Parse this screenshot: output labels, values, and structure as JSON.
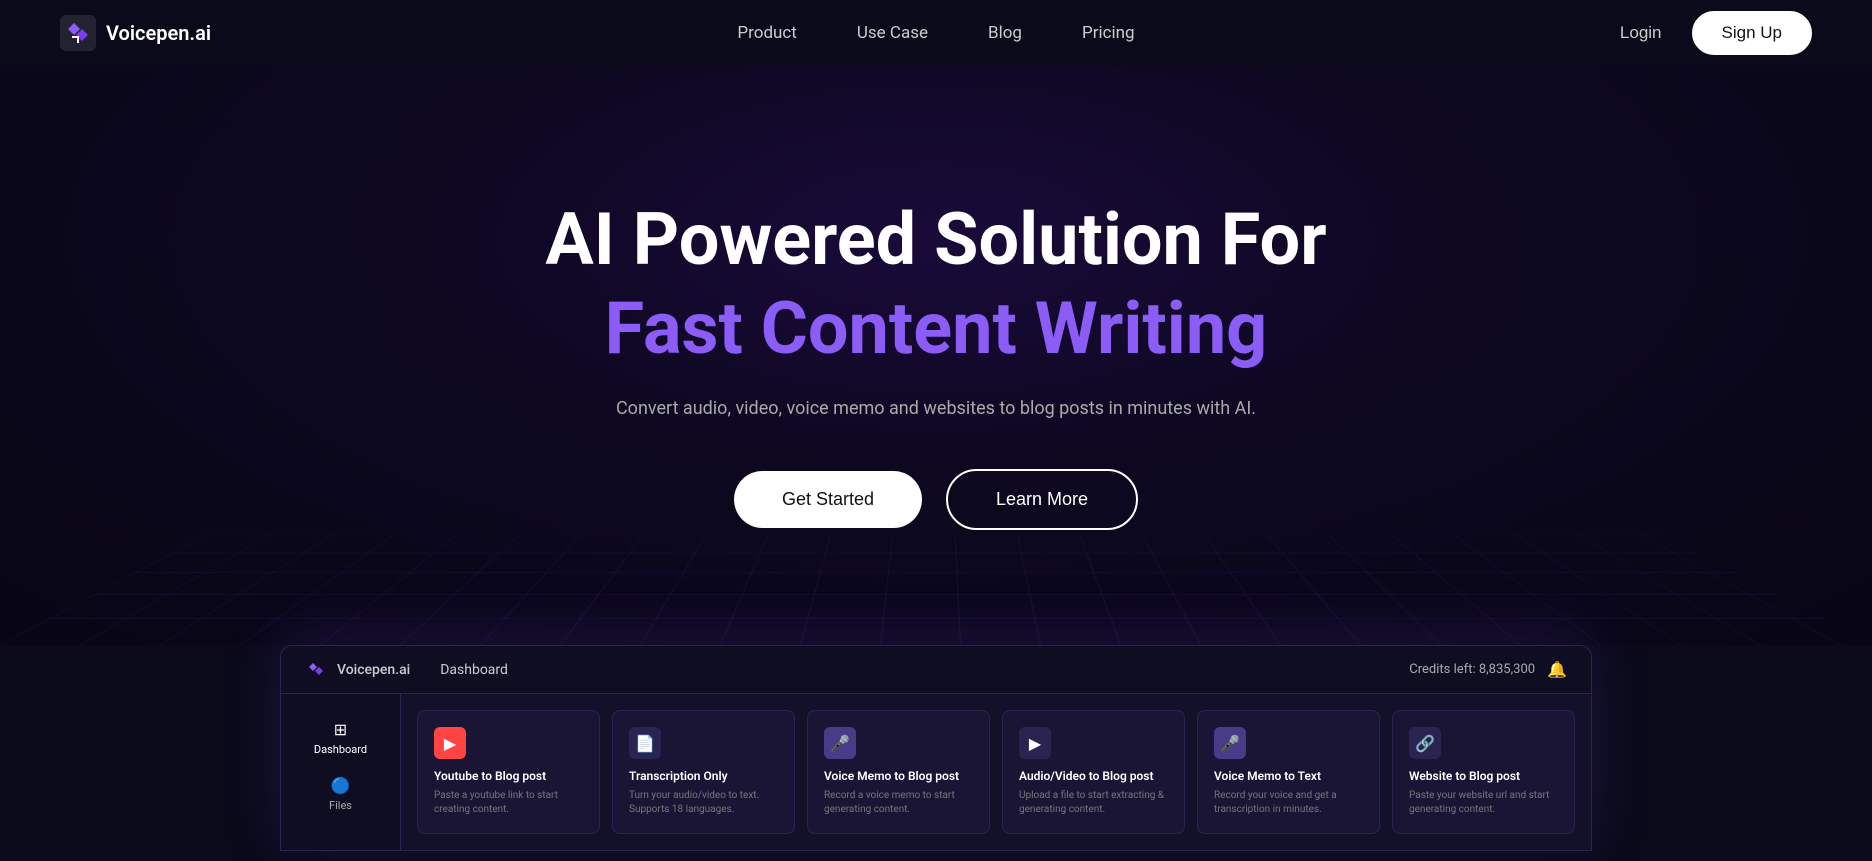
{
  "navbar": {
    "logo_text": "Voicepen.ai",
    "nav_links": [
      {
        "label": "Product",
        "id": "product"
      },
      {
        "label": "Use Case",
        "id": "use-case"
      },
      {
        "label": "Blog",
        "id": "blog"
      },
      {
        "label": "Pricing",
        "id": "pricing"
      }
    ],
    "login_label": "Login",
    "signup_label": "Sign Up"
  },
  "hero": {
    "title_line1": "AI Powered Solution For",
    "title_line2": "Fast Content Writing",
    "description": "Convert audio, video, voice memo and websites to blog posts in minutes with AI.",
    "get_started_label": "Get Started",
    "learn_more_label": "Learn More"
  },
  "dashboard": {
    "logo_text": "Voicepen.ai",
    "title": "Dashboard",
    "credits_label": "Credits left: 8,835,300",
    "sidebar_items": [
      {
        "label": "Dashboard",
        "active": true
      },
      {
        "label": "Files",
        "active": false
      }
    ],
    "feature_cards": [
      {
        "id": "youtube",
        "icon": "▶",
        "icon_style": "red",
        "title": "Youtube to Blog post",
        "desc": "Paste a youtube link to start creating content."
      },
      {
        "id": "transcription",
        "icon": "📄",
        "icon_style": "dark",
        "title": "Transcription Only",
        "desc": "Turn your audio/video to text. Supports 18 languages."
      },
      {
        "id": "voice-memo",
        "icon": "🎤",
        "icon_style": "purple",
        "title": "Voice Memo to Blog post",
        "desc": "Record a voice memo to start generating content."
      },
      {
        "id": "audio-video",
        "icon": "▶",
        "icon_style": "dark",
        "title": "Audio/Video to Blog post",
        "desc": "Upload a file to start extracting & generating content."
      },
      {
        "id": "voice-text",
        "icon": "🎤",
        "icon_style": "purple",
        "title": "Voice Memo to Text",
        "desc": "Record your voice and get a transcription in minutes."
      },
      {
        "id": "website",
        "icon": "🔗",
        "icon_style": "dark",
        "title": "Website to Blog post",
        "desc": "Paste your website url and start generating content."
      }
    ]
  }
}
